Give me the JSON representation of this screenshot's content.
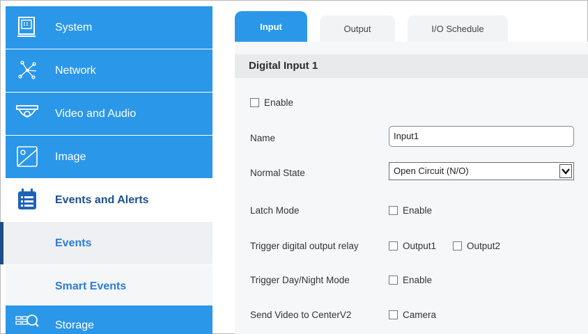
{
  "sidebar": {
    "items": [
      {
        "label": "System",
        "icon": "system-icon"
      },
      {
        "label": "Network",
        "icon": "network-icon"
      },
      {
        "label": "Video and Audio",
        "icon": "camera-dome-icon"
      },
      {
        "label": "Image",
        "icon": "image-icon"
      },
      {
        "label": "Events and Alerts",
        "icon": "calendar-list-icon"
      },
      {
        "label": "Events"
      },
      {
        "label": "Smart Events"
      },
      {
        "label": "Storage",
        "icon": "storage-icon"
      }
    ]
  },
  "tabs": [
    {
      "label": "Input",
      "active": true
    },
    {
      "label": "Output",
      "active": false
    },
    {
      "label": "I/O Schedule",
      "active": false
    }
  ],
  "section": {
    "title": "Digital Input 1"
  },
  "form": {
    "enable_label": "Enable",
    "name_label": "Name",
    "name_value": "Input1",
    "normal_state_label": "Normal State",
    "normal_state_value": "Open Circuit (N/O)",
    "latch_mode_label": "Latch Mode",
    "latch_mode_option": "Enable",
    "trigger_output_label": "Trigger digital output relay",
    "trigger_output_options": [
      "Output1",
      "Output2"
    ],
    "trigger_daynight_label": "Trigger Day/Night Mode",
    "trigger_daynight_option": "Enable",
    "send_video_label": "Send Video to CenterV2",
    "send_video_option": "Camera"
  },
  "colors": {
    "accent": "#2b97e8",
    "active_text": "#1c4f8a",
    "link": "#2b7cd9"
  }
}
